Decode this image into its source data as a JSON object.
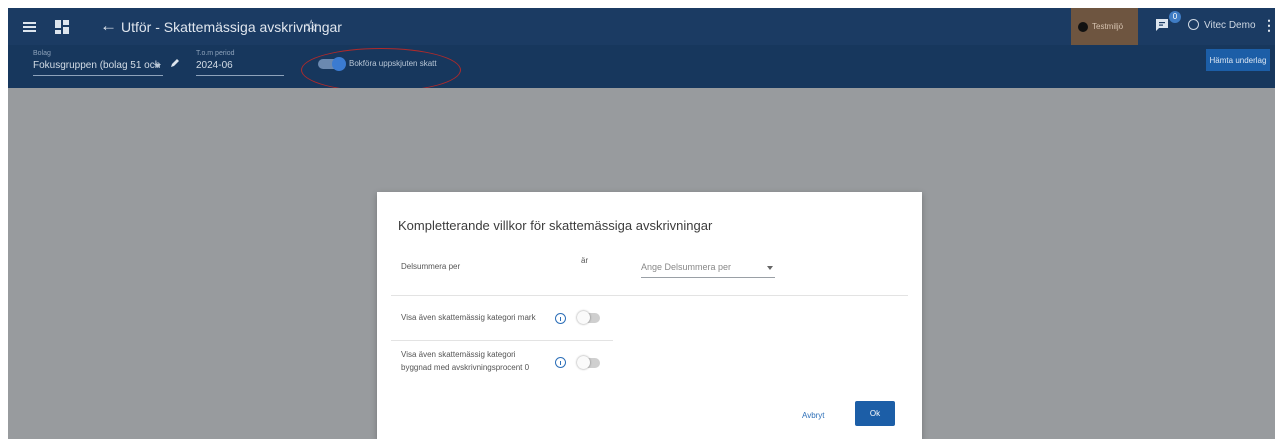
{
  "appbar": {
    "title": "Utför - Skattemässiga avskrivningar",
    "back_arrow": "←",
    "star": "☆",
    "environment_badge": "Testmiljö",
    "notifications_count": "0",
    "user_name": "Vitec Demo",
    "kebab": "⋮"
  },
  "toolbar": {
    "company_label": "Bolag",
    "company_value": "Fokusgruppen (bolag 51 och",
    "period_label": "T.o.m period",
    "period_value": "2024-06",
    "toggle_label": "Bokföra uppskjuten skatt",
    "toggle_on": true,
    "fetch_button": "Hämta underlag"
  },
  "dialog": {
    "title": "Kompletterande villkor för skattemässiga avskrivningar",
    "subtotal_label": "Delsummera per",
    "subtotal_qualifier": "är",
    "subtotal_placeholder": "Ange Delsummera per",
    "option1_label": "Visa även skattemässig kategori mark",
    "option1_on": false,
    "option2_label_line1": "Visa även skattemässig kategori",
    "option2_label_line2": "byggnad med avskrivningsprocent 0",
    "option2_on": false,
    "cancel_label": "Avbryt",
    "ok_label": "Ok"
  },
  "colors": {
    "appbar": "#1b3b63",
    "toolbar": "#17375d",
    "accent": "#1c5ea7",
    "annotation_circle": "#b02a2a",
    "scrim": "#989b9e"
  }
}
